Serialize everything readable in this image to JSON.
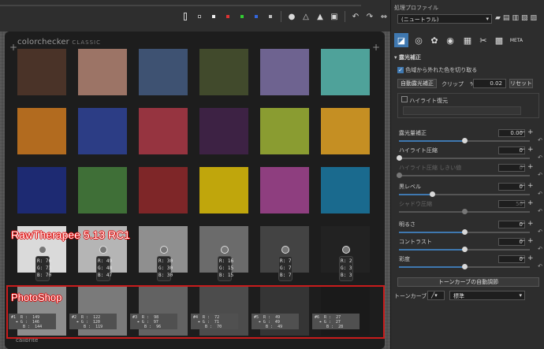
{
  "toolbar": {
    "icons": [
      "histogram-icon",
      "black-square",
      "white-square",
      "red-square",
      "green-square",
      "blue-square",
      "luminance-square",
      "bullet-icon",
      "warning-low-icon",
      "warning-high-icon",
      "focus-icon",
      "rotate-left-icon",
      "rotate-right-icon",
      "flip-h-icon",
      "flip-v-icon"
    ]
  },
  "checker": {
    "logo": "colorchecker",
    "logo_sub": "CLASSIC",
    "swatch_rows": [
      [
        "#4a3328",
        "#9c7466",
        "#3e5272",
        "#414a2c",
        "#6e6390",
        "#4fa29a"
      ],
      [
        "#b26b1f",
        "#2c3d85",
        "#963440",
        "#3d2244",
        "#8a9c31",
        "#c58f23"
      ],
      [
        "#1d2a72",
        "#3f6f37",
        "#7e2628",
        "#c0a60c",
        "#8e3e7f",
        "#1a6a8e"
      ],
      [
        "#dadada",
        "#b5b5b5",
        "#8f8f8f",
        "#6b6b6b",
        "#434343",
        "#222222"
      ]
    ],
    "rt_readings": [
      {
        "r": "R: 76",
        "g": "G: 73",
        "b": "B: 70"
      },
      {
        "r": "R: 49",
        "g": "G: 48",
        "b": "B: 47"
      },
      {
        "r": "R: 30",
        "g": "G: 30",
        "b": "B: 30"
      },
      {
        "r": "R: 16",
        "g": "G: 15",
        "b": "B: 15"
      },
      {
        "r": "R: 7",
        "g": "G: 7",
        "b": "B: 7"
      },
      {
        "r": "R: 2",
        "g": "G: 3",
        "b": "B: 3"
      }
    ],
    "ps_readings": [
      {
        "n": "#1",
        "r": "149",
        "g": "146",
        "b": "144"
      },
      {
        "n": "#2",
        "r": "122",
        "g": "120",
        "b": "119"
      },
      {
        "n": "#3",
        "r": "98",
        "g": "97",
        "b": "96"
      },
      {
        "n": "#4",
        "r": "72",
        "g": "71",
        "b": "70"
      },
      {
        "n": "#5",
        "r": "49",
        "g": "49",
        "b": "49"
      },
      {
        "n": "#6",
        "r": "27",
        "g": "27",
        "b": "28"
      }
    ],
    "bottom_logo": "calibrite"
  },
  "captions": {
    "rawtherapee": "RawTherapee 5.13 RC1",
    "photoshop": "PhotoShop"
  },
  "panel": {
    "profile_header": "処理プロファイル",
    "profile_value": "(ニュートラル)",
    "tab_meta": "META",
    "section_exposure": "露光補正",
    "clip_checkbox": "色域から外れた色を切り取る",
    "auto_exposure_btn": "自動露光補正",
    "clip_label": "クリップ",
    "clip_unit": "%",
    "clip_value": "0.02",
    "reset_btn": "リセット",
    "highlight_restore": "ハイライト復元",
    "exposure_comp": "露光量補正",
    "exposure_val": "0.00",
    "highlight_comp": "ハイライト圧縮",
    "highlight_val": "0",
    "highlight_thresh": "ハイライト圧縮 しきい値",
    "highlight_thresh_val": "0",
    "black_level": "黒レベル",
    "black_val": "0",
    "shadow_comp": "シャドウ圧縮",
    "shadow_val": "50",
    "lightness": "明るさ",
    "lightness_val": "0",
    "contrast": "コントラスト",
    "contrast_val": "0",
    "saturation": "彩度",
    "saturation_val": "0",
    "auto_tone_btn": "トーンカーブの自動調節",
    "tone_curve1": "トーンカーブ1",
    "tone_mode": "標準"
  }
}
